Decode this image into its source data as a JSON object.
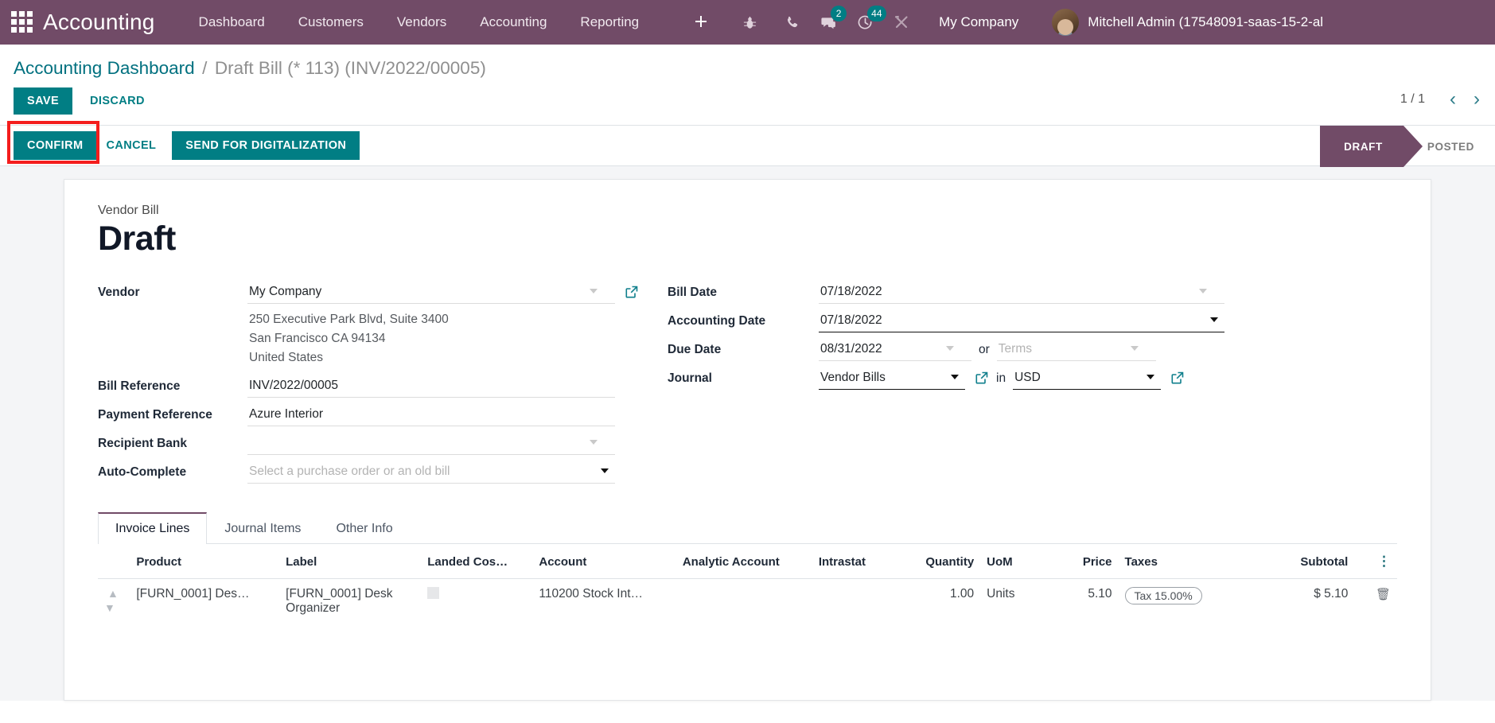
{
  "topbar": {
    "brand": "Accounting",
    "apps_icon": "apps-grid-icon",
    "nav": [
      "Dashboard",
      "Customers",
      "Vendors",
      "Accounting",
      "Reporting"
    ],
    "plus_label": "+",
    "icons": [
      {
        "name": "bug-icon",
        "badge": null
      },
      {
        "name": "phone-icon",
        "badge": null
      },
      {
        "name": "messages-icon",
        "badge": "2"
      },
      {
        "name": "activities-clock-icon",
        "badge": "44"
      },
      {
        "name": "wrench-tools-icon",
        "badge": null
      }
    ],
    "company": "My Company",
    "user": "Mitchell Admin (17548091-saas-15-2-al",
    "bg_color": "#714B67"
  },
  "breadcrumb": {
    "root": "Accounting Dashboard",
    "separator": "/",
    "current": "Draft Bill (* 113) (INV/2022/00005)"
  },
  "controls": {
    "save_label": "SAVE",
    "discard_label": "DISCARD",
    "pager_count": "1 / 1",
    "prev_icon": "‹",
    "next_icon": "›"
  },
  "actionbar": {
    "confirm_label": "CONFIRM",
    "cancel_label": "CANCEL",
    "digitalization_label": "SEND FOR DIGITALIZATION",
    "highlight_color": "#f41d1d",
    "highlighted_button": "CONFIRM",
    "statuses": [
      {
        "label": "DRAFT",
        "active": true
      },
      {
        "label": "POSTED",
        "active": false
      }
    ]
  },
  "sheet": {
    "doc_type": "Vendor Bill",
    "doc_state": "Draft",
    "left_fields": {
      "vendor_label": "Vendor",
      "vendor_value": "My Company",
      "vendor_address": [
        "250 Executive Park Blvd, Suite 3400",
        "San Francisco CA 94134",
        "United States"
      ],
      "bill_reference_label": "Bill Reference",
      "bill_reference_value": "INV/2022/00005",
      "payment_reference_label": "Payment Reference",
      "payment_reference_value": "Azure Interior",
      "recipient_bank_label": "Recipient Bank",
      "recipient_bank_value": "",
      "autocomplete_label": "Auto-Complete",
      "autocomplete_value": "",
      "autocomplete_placeholder": "Select a purchase order or an old bill"
    },
    "right_fields": {
      "bill_date_label": "Bill Date",
      "bill_date_value": "07/18/2022",
      "accounting_date_label": "Accounting Date",
      "accounting_date_value": "07/18/2022",
      "due_date_label": "Due Date",
      "due_date_value": "08/31/2022",
      "or_word": "or",
      "terms_placeholder": "Terms",
      "terms_value": "",
      "journal_label": "Journal",
      "journal_value": "Vendor Bills",
      "in_word": "in",
      "currency_value": "USD"
    }
  },
  "tabs": [
    {
      "label": "Invoice Lines",
      "active": true
    },
    {
      "label": "Journal Items",
      "active": false
    },
    {
      "label": "Other Info",
      "active": false
    }
  ],
  "lines_table": {
    "columns": [
      "Product",
      "Label",
      "Landed Cos…",
      "Account",
      "Analytic Account",
      "Intrastat",
      "Quantity",
      "UoM",
      "Price",
      "Taxes",
      "Subtotal"
    ],
    "optional_cols_icon": "vertical-dots-icon",
    "rows": [
      {
        "drag": "drag-handle-icon",
        "product": "[FURN_0001] Des…",
        "label": "[FURN_0001] Desk Organizer",
        "landed_cost": "",
        "account": "110200 Stock Int…",
        "analytic_account": "",
        "intrastat": "",
        "quantity": "1.00",
        "uom": "Units",
        "price": "5.10",
        "taxes": "Tax 15.00%",
        "subtotal": "$ 5.10",
        "delete_icon": "trash-icon"
      }
    ]
  }
}
